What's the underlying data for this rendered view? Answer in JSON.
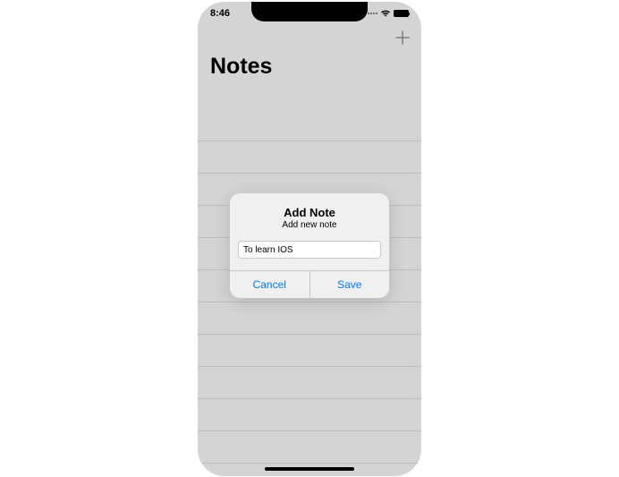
{
  "status_bar": {
    "time": "8:46"
  },
  "header": {
    "title": "Notes"
  },
  "alert": {
    "title": "Add Note",
    "subtitle": "Add new note",
    "input_value": "To learn IOS",
    "cancel_label": "Cancel",
    "save_label": "Save"
  }
}
